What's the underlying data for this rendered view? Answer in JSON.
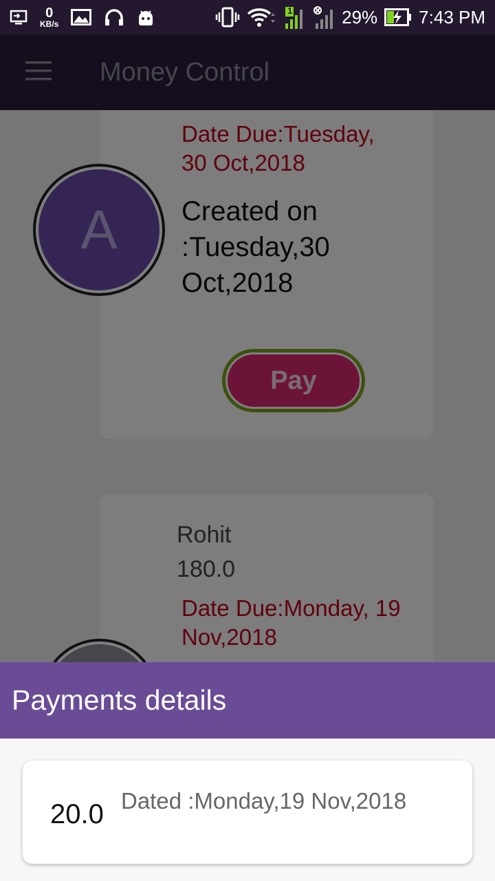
{
  "status_bar": {
    "kbs_value": "0",
    "kbs_unit": "KB/s",
    "sim_badge": "1",
    "battery": "29%",
    "time": "7:43 PM",
    "icons": [
      "cast-icon",
      "image-icon",
      "headphones-icon",
      "android-icon",
      "vibrate-icon",
      "wifi-icon",
      "signal-icon",
      "no-signal-icon",
      "battery-charging-icon"
    ]
  },
  "app_bar": {
    "title": "Money Control",
    "menu_icon": "menu-icon"
  },
  "cards": [
    {
      "avatar_letter": "A",
      "date_due": "Date Due:Tuesday, 30 Oct,2018",
      "created": "Created on :Tuesday,30 Oct,2018",
      "pay_label": "Pay"
    },
    {
      "name": "Rohit",
      "amount": "180.0",
      "date_due": "Date Due:Monday, 19 Nov,2018"
    }
  ],
  "sheet": {
    "title": "Payments details",
    "payments": [
      {
        "amount": "20.0",
        "dated": "Dated :Monday,19 Nov,2018"
      }
    ]
  },
  "colors": {
    "app_bar": "#281d3d",
    "sheet_header": "#6a4c96",
    "due_text": "#c0001a",
    "pay_button": "#d8286f",
    "pay_border": "#78a21a"
  }
}
